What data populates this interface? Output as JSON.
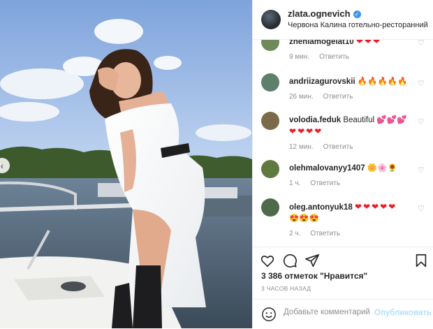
{
  "post": {
    "username": "zlata.ognevich",
    "location": "Червона Калина готельно-ресторанний ко...",
    "likes": "3 386 отметок \"Нравится\"",
    "time": "3 ЧАСОВ НАЗАД"
  },
  "comments": [
    {
      "user": "zhenlamogelat10",
      "text": "",
      "emoji": [
        "❤",
        "❤",
        "❤"
      ],
      "emoji2": [],
      "time": "9 мин.",
      "reply": "Ответить",
      "avatar_color": "#6f8a5a"
    },
    {
      "user": "andriizagurovskii",
      "text": "",
      "emoji": [
        "🔥",
        "🔥",
        "🔥",
        "🔥",
        "🔥"
      ],
      "emoji2": [],
      "time": "26 мин.",
      "reply": "Ответить",
      "avatar_color": "#5d7f6c"
    },
    {
      "user": "volodia.feduk",
      "text": "Beautiful",
      "emoji": [
        "💕",
        "💕",
        "💕"
      ],
      "emoji2": [
        "❤",
        "❤",
        "❤",
        "❤"
      ],
      "time": "12 мин.",
      "reply": "Ответить",
      "avatar_color": "#7a6a4a"
    },
    {
      "user": "olehmalovanyy1407",
      "text": "",
      "emoji": [
        "🌼",
        "🌸",
        "🌻"
      ],
      "emoji2": [],
      "time": "1 ч.",
      "reply": "Ответить",
      "avatar_color": "#5f7a3e"
    },
    {
      "user": "oleg.antonyuk18",
      "text": "",
      "emoji": [
        "❤",
        "❤",
        "❤",
        "❤",
        "❤"
      ],
      "emoji2": [
        "😍",
        "😍",
        "😍"
      ],
      "time": "2 ч.",
      "reply": "Ответить",
      "avatar_color": "#4e6a4a"
    }
  ],
  "add_comment": {
    "placeholder": "Добавьте комментарий...",
    "post_label": "Опубликовать"
  },
  "icons": {
    "like": "heart-outline-icon",
    "comment": "speech-bubble-icon",
    "share": "paper-plane-icon",
    "save": "bookmark-icon",
    "emoji": "smiley-icon",
    "prev": "chevron-left-icon"
  }
}
